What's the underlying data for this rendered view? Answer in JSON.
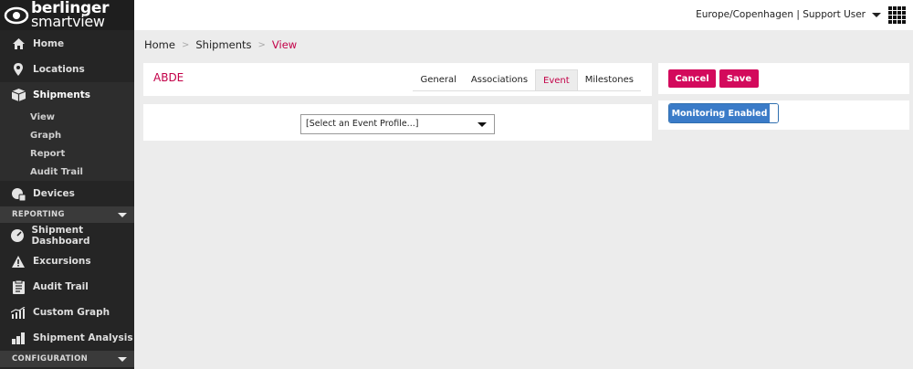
{
  "brand": {
    "line1": "berlinger",
    "line2": "smartview"
  },
  "topbar": {
    "user_info": "Europe/Copenhagen | Support User"
  },
  "sidebar": {
    "items": [
      {
        "label": "Home",
        "icon": "home-icon"
      },
      {
        "label": "Locations",
        "icon": "map-pin-icon"
      },
      {
        "label": "Shipments",
        "icon": "box-icon"
      }
    ],
    "shipments_sub": [
      "View",
      "Graph",
      "Report",
      "Audit Trail"
    ],
    "devices": {
      "label": "Devices",
      "icon": "device-icon"
    },
    "reporting_section": "REPORTING",
    "reporting_items": [
      {
        "label": "Shipment Dashboard",
        "icon": "gauge-icon"
      },
      {
        "label": "Excursions",
        "icon": "warning-icon"
      },
      {
        "label": "Audit Trail",
        "icon": "clipboard-icon"
      },
      {
        "label": "Custom Graph",
        "icon": "chart-icon"
      },
      {
        "label": "Shipment Analysis",
        "icon": "bar-chart-icon"
      }
    ],
    "configuration_section": "CONFIGURATION"
  },
  "breadcrumb": {
    "home": "Home",
    "shipments": "Shipments",
    "current": "View"
  },
  "shipment": {
    "title": "ABDE"
  },
  "tabs": [
    "General",
    "Associations",
    "Event",
    "Milestones"
  ],
  "event": {
    "select_placeholder": "[Select an Event Profile...]"
  },
  "actions": {
    "cancel": "Cancel",
    "save": "Save"
  },
  "monitoring": {
    "label": "Monitoring Enabled"
  },
  "colors": {
    "accent": "#c30048",
    "button": "#d30a5c",
    "toggle": "#3a7bc8",
    "sidebar": "#252525"
  }
}
